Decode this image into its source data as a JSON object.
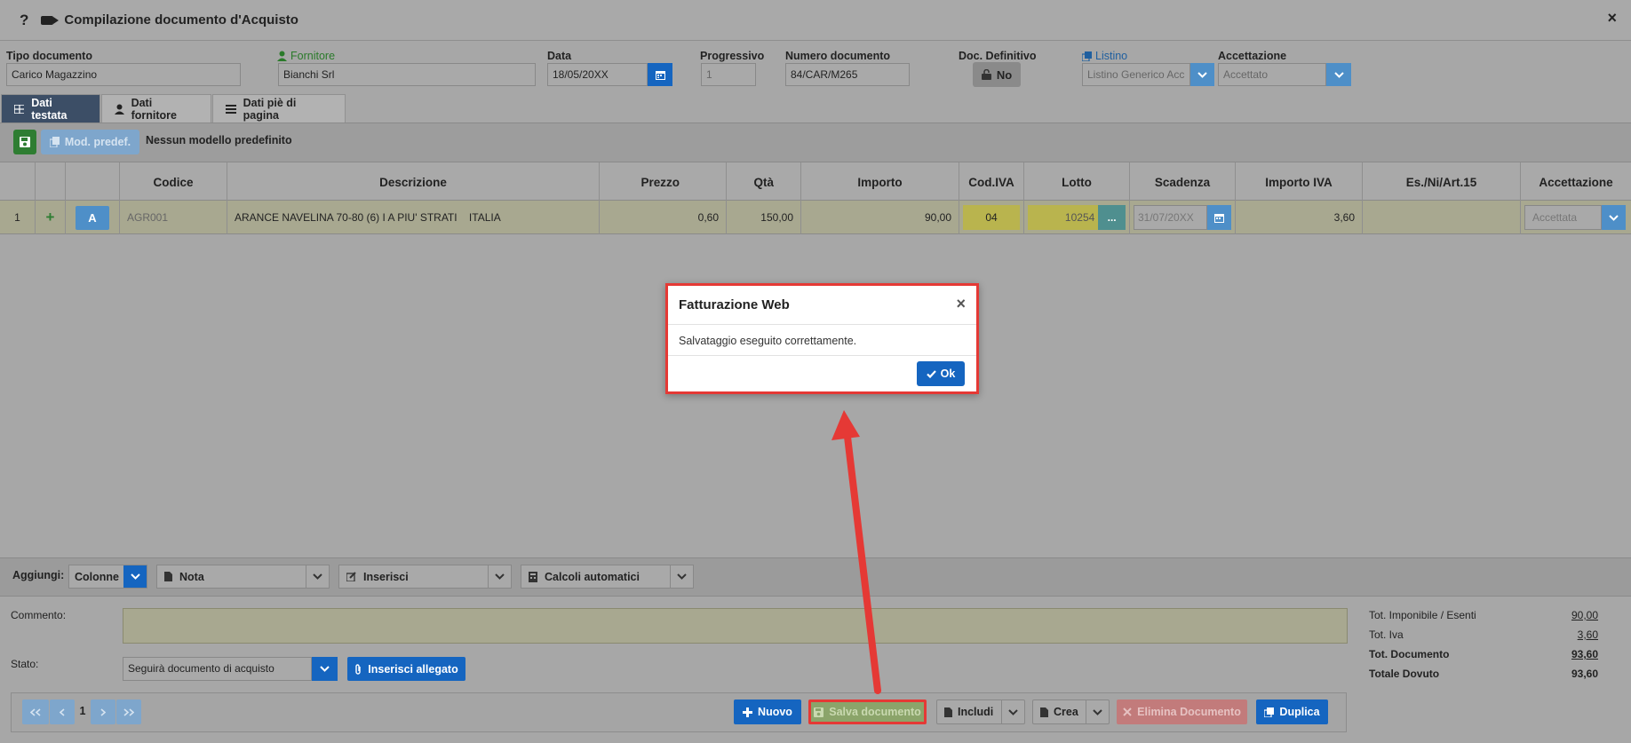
{
  "window": {
    "title": "Compilazione documento d'Acquisto",
    "help": "?",
    "close": "×"
  },
  "header": {
    "tipo_label": "Tipo documento",
    "tipo_value": "Carico Magazzino",
    "fornitore_label": "Fornitore",
    "fornitore_value": "Bianchi Srl",
    "data_label": "Data",
    "data_value": "18/05/20XX",
    "progressivo_label": "Progressivo",
    "progressivo_value": "1",
    "numero_label": "Numero documento",
    "numero_value": "84/CAR/M265",
    "definitivo_label": "Doc. Definitivo",
    "definitivo_value": "No",
    "listino_label": "Listino",
    "listino_value": "Listino Generico Acc",
    "accettazione_label": "Accettazione",
    "accettazione_value": "Accettato"
  },
  "tabs": [
    {
      "label": "Dati testata"
    },
    {
      "label": "Dati fornitore"
    },
    {
      "label": "Dati piè di pagina"
    }
  ],
  "toolbar": {
    "mod_predef": "Mod. predef.",
    "no_model": "Nessun modello predefinito"
  },
  "table": {
    "columns": [
      "Codice",
      "Descrizione",
      "Prezzo",
      "Qtà",
      "Importo",
      "Cod.IVA",
      "Lotto",
      "Scadenza",
      "Importo IVA",
      "Es./Ni/Art.15",
      "Accettazione"
    ],
    "rows": [
      {
        "n": "1",
        "plus": "+",
        "a": "A",
        "codice": "AGR001",
        "descrizione": "ARANCE NAVELINA 70-80 (6) I A PIU' STRATI    ITALIA",
        "prezzo": "0,60",
        "qta": "150,00",
        "importo": "90,00",
        "cod_iva": "04",
        "lotto": "10254",
        "lotto_btn": "...",
        "scadenza": "31/07/20XX",
        "importo_iva": "3,60",
        "es": "",
        "accettazione": "Accettata"
      }
    ]
  },
  "addbar": {
    "label": "Aggiungi:",
    "colonne": "Colonne",
    "nota": "Nota",
    "inserisci": "Inserisci",
    "calcoli": "Calcoli automatici"
  },
  "bottom": {
    "commento_label": "Commento:",
    "stato_label": "Stato:",
    "stato_value": "Seguirà documento di acquisto",
    "allegato": "Inserisci allegato"
  },
  "totals": [
    {
      "label": "Tot. Imponibile / Esenti",
      "value": "90,00",
      "bold": false
    },
    {
      "label": "Tot. Iva",
      "value": "3,60",
      "bold": false
    },
    {
      "label": "Tot. Documento",
      "value": "93,60",
      "bold": true
    },
    {
      "label": "Totale Dovuto",
      "value": "93,60",
      "bold": true
    }
  ],
  "footer": {
    "page": "1",
    "nuovo": "Nuovo",
    "salva": "Salva documento",
    "includi": "Includi",
    "crea": "Crea",
    "elimina": "Elimina Documento",
    "duplica": "Duplica"
  },
  "modal": {
    "title": "Fatturazione Web",
    "message": "Salvataggio eseguito correttamente.",
    "ok": "Ok",
    "close": "×"
  },
  "colors": {
    "accent": "#1565c0",
    "highlight": "#e53935",
    "save": "#2e7d32"
  }
}
